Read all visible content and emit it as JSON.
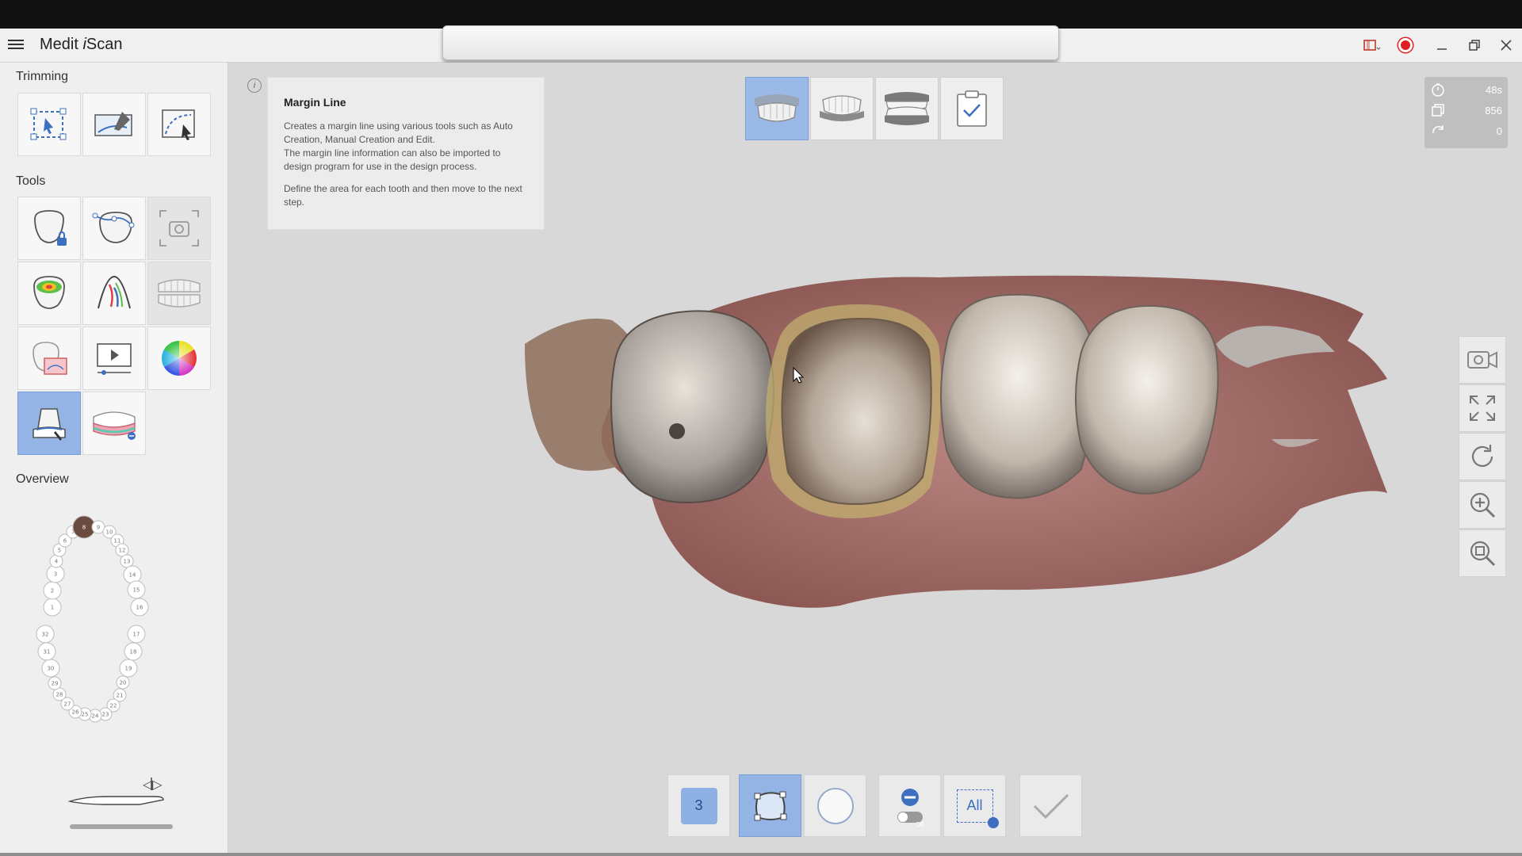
{
  "app": {
    "title_prefix": "Medit ",
    "title_italic": "i",
    "title_suffix": "Scan"
  },
  "sidebar": {
    "trimming_title": "Trimming",
    "tools_title": "Tools",
    "overview_title": "Overview"
  },
  "info_panel": {
    "title": "Margin Line",
    "paragraph1": "Creates a margin line using various tools such as Auto Creation, Manual Creation and Edit.",
    "paragraph2": "The margin line information can also be imported to design program for use in the design process.",
    "paragraph3": "Define the area for each tooth and then move to the next step."
  },
  "stats": {
    "time": "48s",
    "frames": "856",
    "rotation": "0"
  },
  "bottom_toolbar": {
    "tooth_number": "3",
    "all_label": "All",
    "toggle_label": "Off"
  },
  "overview": {
    "selected_tooth": "8",
    "teeth": [
      "1",
      "2",
      "3",
      "4",
      "5",
      "6",
      "7",
      "8",
      "9",
      "10",
      "11",
      "12",
      "13",
      "14",
      "15",
      "16",
      "17",
      "18",
      "19",
      "20",
      "21",
      "22",
      "23",
      "24",
      "25",
      "26",
      "27",
      "28",
      "29",
      "30",
      "31",
      "32"
    ]
  },
  "colors": {
    "accent": "#93b4e4",
    "selected_tooth": "#6b4a3f",
    "record": "#e02020"
  }
}
